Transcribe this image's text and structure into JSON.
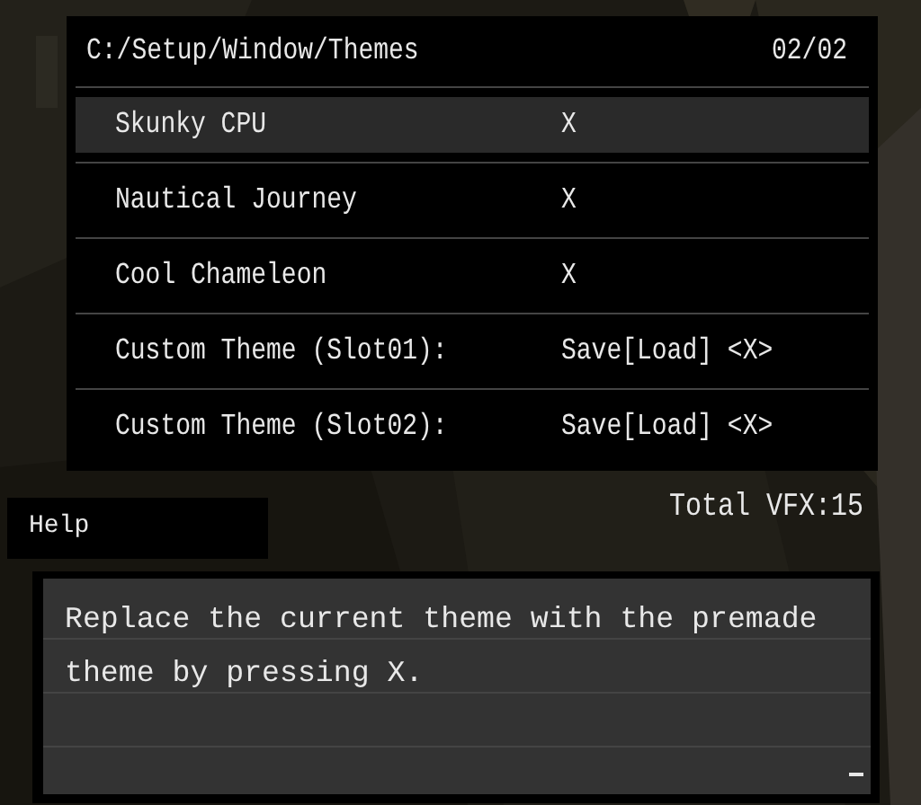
{
  "menu": {
    "path": "C:/Setup/Window/Themes",
    "page": "02/02",
    "items": [
      {
        "label": "Skunky CPU",
        "value": "X",
        "selected": true
      },
      {
        "label": "Nautical Journey",
        "value": "X",
        "selected": false
      },
      {
        "label": "Cool Chameleon",
        "value": "X",
        "selected": false
      },
      {
        "label": "Custom Theme (Slot01):",
        "value": "Save[Load] <X>",
        "selected": false
      },
      {
        "label": "Custom Theme (Slot02):",
        "value": "Save[Load] <X>",
        "selected": false
      }
    ]
  },
  "total": "Total VFX:15",
  "help": {
    "title": "Help",
    "text": "Replace the current theme with the premade theme by pressing X."
  }
}
